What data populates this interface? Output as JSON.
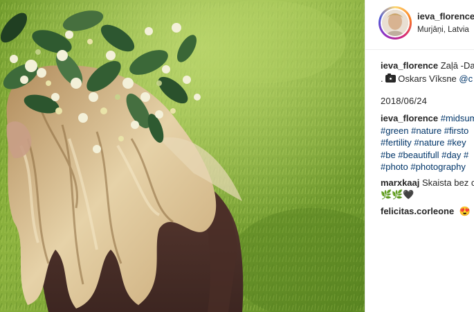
{
  "post": {
    "username": "ieva_florence",
    "location": "Murjāņi, Latvia",
    "caption_start": "Zaļā -Da",
    "photo_credit_prefix": ".",
    "photo_credit_name": "Oskars Vīksne",
    "photo_credit_mention": "@c",
    "date": "2018/06/24"
  },
  "hashtags": {
    "author": "ieva_florence",
    "line1": "#midsum",
    "line2": "#green #nature #firsto",
    "line3": "#fertility #nature #key",
    "line4": "#be #beautifull #day #",
    "line5": "#photo #photography"
  },
  "comments": [
    {
      "user": "marxkaaj",
      "text": "Skaista bez c",
      "emoji": "🌿🌿🖤"
    },
    {
      "user": "felicitas.corleone",
      "emoji": "😍"
    }
  ],
  "icons": {
    "camera": "camera-icon",
    "heart": "heart-emoji",
    "leaf": "leaf-emoji",
    "heart_eyes": "heart-eyes-emoji"
  },
  "colors": {
    "username": "#262626",
    "hashtag": "#003569",
    "divider": "#efefef",
    "grass": "#8cae3a"
  }
}
